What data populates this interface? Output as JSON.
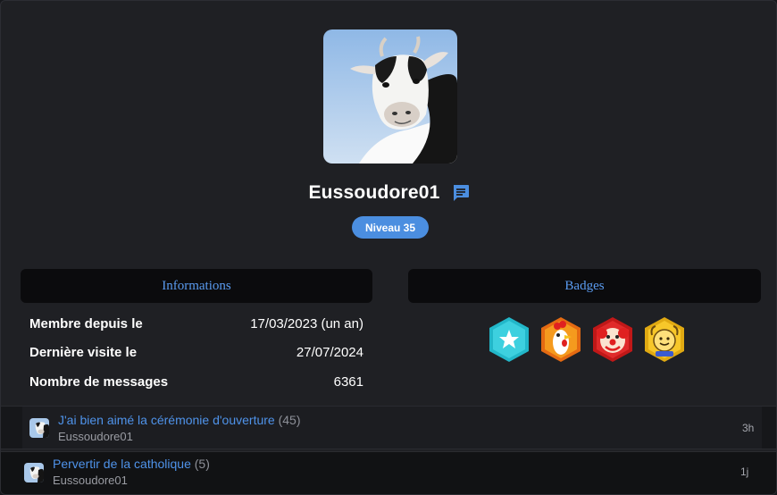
{
  "profile": {
    "username": "Eussoudore01",
    "level": "Niveau 35"
  },
  "panels": {
    "info_title": "Informations",
    "badges_title": "Badges"
  },
  "info": [
    {
      "label": "Membre depuis le",
      "value": "17/03/2023 (un an)"
    },
    {
      "label": "Dernière visite le",
      "value": "27/07/2024"
    },
    {
      "label": "Nombre de messages",
      "value": "6361"
    }
  ],
  "badges": [
    "star-badge-icon",
    "rooster-badge-icon",
    "clown-badge-icon",
    "smiley-badge-icon"
  ],
  "topics": [
    {
      "title": "J'ai bien aimé la cérémonie d'ouverture",
      "count": "(45)",
      "author": "Eussoudore01",
      "time": "3h"
    },
    {
      "title": "Pervertir de la catholique",
      "count": "(5)",
      "author": "Eussoudore01",
      "time": "1j"
    }
  ],
  "colors": {
    "accent": "#4b8ee0",
    "link": "#4f93ea",
    "background": "#1f2024"
  }
}
